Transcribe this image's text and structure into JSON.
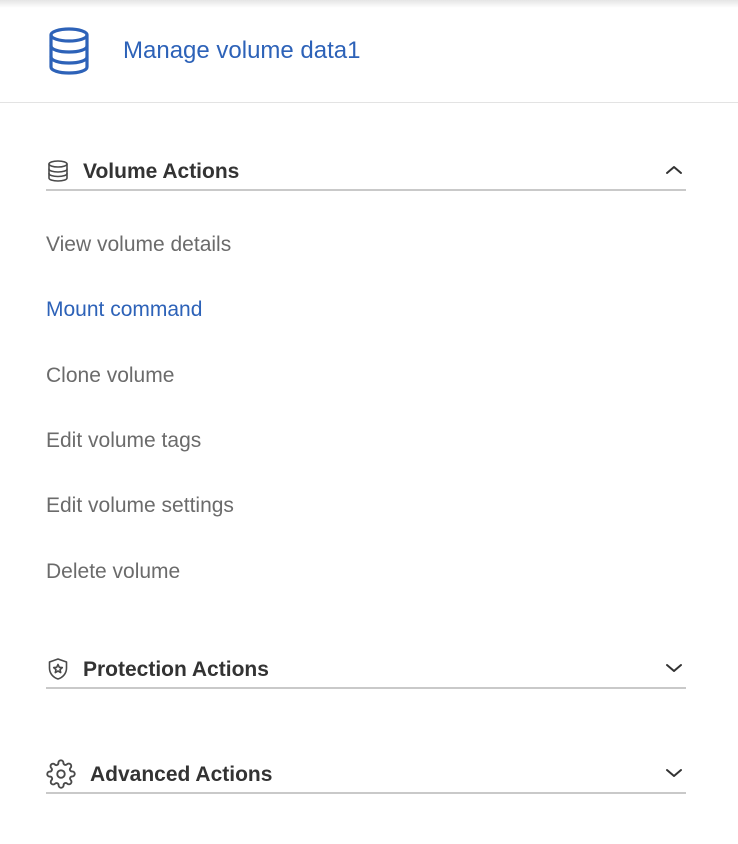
{
  "header": {
    "title": "Manage volume data1",
    "icon": "database-icon"
  },
  "sections": [
    {
      "label": "Volume Actions",
      "icon": "database-icon",
      "expanded": true,
      "items": [
        {
          "label": "View volume details",
          "active": false
        },
        {
          "label": "Mount command",
          "active": true
        },
        {
          "label": "Clone volume",
          "active": false
        },
        {
          "label": "Edit volume tags",
          "active": false
        },
        {
          "label": "Edit volume settings",
          "active": false
        },
        {
          "label": "Delete volume",
          "active": false
        }
      ]
    },
    {
      "label": "Protection Actions",
      "icon": "shield-star-icon",
      "expanded": false
    },
    {
      "label": "Advanced Actions",
      "icon": "gear-icon",
      "expanded": false
    }
  ],
  "colors": {
    "accent": "#2d62b8",
    "item_text": "#6b6b6b",
    "heading_text": "#333333",
    "divider": "#c9c9c9"
  }
}
